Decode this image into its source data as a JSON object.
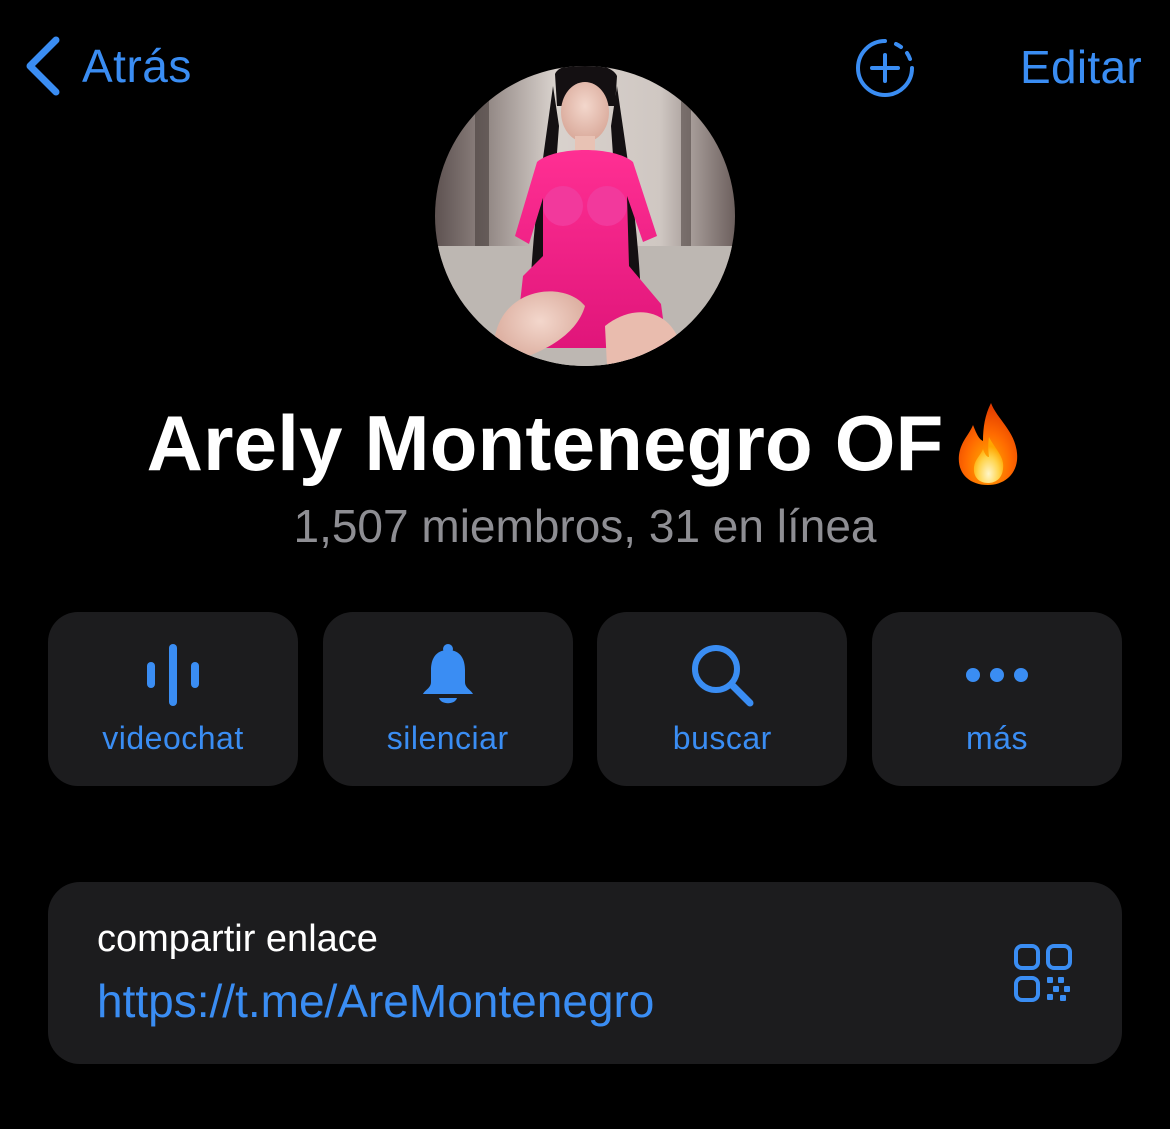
{
  "nav": {
    "back_label": "Atrás",
    "edit_label": "Editar",
    "add_icon": "add-story-icon"
  },
  "profile": {
    "name": "Arely Montenegro OF",
    "emoji": "fire-emoji",
    "status": "1,507 miembros, 31 en línea"
  },
  "actions": [
    {
      "label": "videochat",
      "icon": "waveform-icon"
    },
    {
      "label": "silenciar",
      "icon": "bell-icon"
    },
    {
      "label": "buscar",
      "icon": "search-icon"
    },
    {
      "label": "más",
      "icon": "ellipsis-icon"
    }
  ],
  "link": {
    "caption": "compartir enlace",
    "url": "https://t.me/AreMontenegro",
    "icon": "qr-code-icon"
  },
  "colors": {
    "background": "#000000",
    "card": "#1c1c1e",
    "accent": "#3a8df3",
    "secondary_text": "#8e8e93"
  }
}
